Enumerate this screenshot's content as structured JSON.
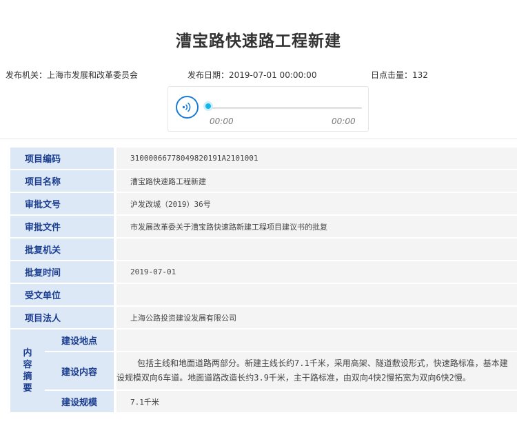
{
  "title": "漕宝路快速路工程新建",
  "meta": {
    "publisher": "发布机关：上海市发展和改革委员会",
    "date": "发布日期：2019-07-01 00:00:00",
    "clicks": "日点击量：132"
  },
  "player": {
    "current_time": "00:00",
    "duration": "00:00",
    "icon": "audio-wave-icon",
    "progress": 0
  },
  "rows": [
    {
      "label": "项目编码",
      "value": "3100006677804982019​1A2101001"
    },
    {
      "label": "项目名称",
      "value": "漕宝路快速路工程新建"
    },
    {
      "label": "审批文号",
      "value": "沪发改城（2019）36号"
    },
    {
      "label": "审批文件",
      "value": "市发展改革委关于漕宝路快速路新建工程项目建议书的批复"
    },
    {
      "label": "批复机关",
      "value": ""
    },
    {
      "label": "批复时间",
      "value": "2019-07-01"
    },
    {
      "label": "受文单位",
      "value": ""
    },
    {
      "label": "项目法人",
      "value": "上海公路投资建设发展有限公司"
    }
  ],
  "summary": {
    "label": "内容摘要",
    "label_chars": [
      "内",
      "容",
      "摘",
      "要"
    ],
    "items": [
      {
        "label": "建设地点",
        "value": ""
      },
      {
        "label": "建设内容",
        "value": "包括主线和地面道路两部分。新建主线长约7.1千米，采用高架、隧道敷设形式，快速路标准，基本建设规模双向6车道。地面道路改造长约3.9千米，主干路标准，由双向4快2慢拓宽为双向6快2慢。"
      },
      {
        "label": "建设规模",
        "value": "7.1千米"
      }
    ]
  }
}
